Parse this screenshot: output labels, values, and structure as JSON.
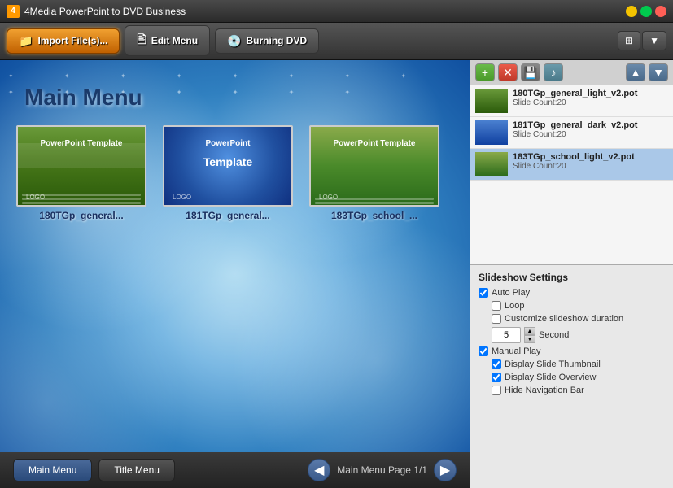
{
  "titleBar": {
    "icon": "4",
    "title": "4Media PowerPoint to DVD Business"
  },
  "toolbar": {
    "importBtn": "Import File(s)...",
    "editMenuBtn": "Edit Menu",
    "burningDvdBtn": "Burning DVD"
  },
  "preview": {
    "title": "Main Menu",
    "thumbnails": [
      {
        "id": "thumb1",
        "label": "180TGp_general...",
        "style": "green-stripe",
        "text1": "PowerPoint Template",
        "text2": ""
      },
      {
        "id": "thumb2",
        "label": "181TGp_general...",
        "style": "blue-ppt",
        "text1": "PowerPoint",
        "text2": "Template"
      },
      {
        "id": "thumb3",
        "label": "183TGp_school_...",
        "style": "green-school",
        "text1": "PowerPoint Template",
        "text2": ""
      }
    ]
  },
  "bottomBar": {
    "mainMenuBtn": "Main Menu",
    "titleMenuBtn": "Title Menu",
    "pageInfo": "Main Menu Page 1/1"
  },
  "fileList": {
    "toolbarBtns": {
      "add": "+",
      "remove": "✕",
      "save": "💾",
      "music": "♪",
      "up": "▲",
      "down": "▼"
    },
    "files": [
      {
        "name": "180TGp_general_light_v2.pot",
        "count": "Slide Count:20",
        "style": "green"
      },
      {
        "name": "181TGp_general_dark_v2.pot",
        "count": "Slide Count:20",
        "style": "blue"
      },
      {
        "name": "183TGp_school_light_v2.pot",
        "count": "Slide Count:20",
        "style": "school",
        "selected": true
      }
    ]
  },
  "slideshowSettings": {
    "title": "Slideshow Settings",
    "autoPlay": {
      "label": "Auto Play",
      "checked": true
    },
    "loop": {
      "label": "Loop",
      "checked": false
    },
    "customizeDuration": {
      "label": "Customize slideshow duration",
      "checked": false
    },
    "durationValue": "5",
    "durationUnit": "Second",
    "manualPlay": {
      "label": "Manual Play",
      "checked": true
    },
    "displaySlideThumbnail": {
      "label": "Display Slide Thumbnail",
      "checked": true
    },
    "displaySlideOverview": {
      "label": "Display Slide Overview",
      "checked": true
    },
    "hideNavigationBar": {
      "label": "Hide Navigation Bar",
      "checked": false
    }
  }
}
